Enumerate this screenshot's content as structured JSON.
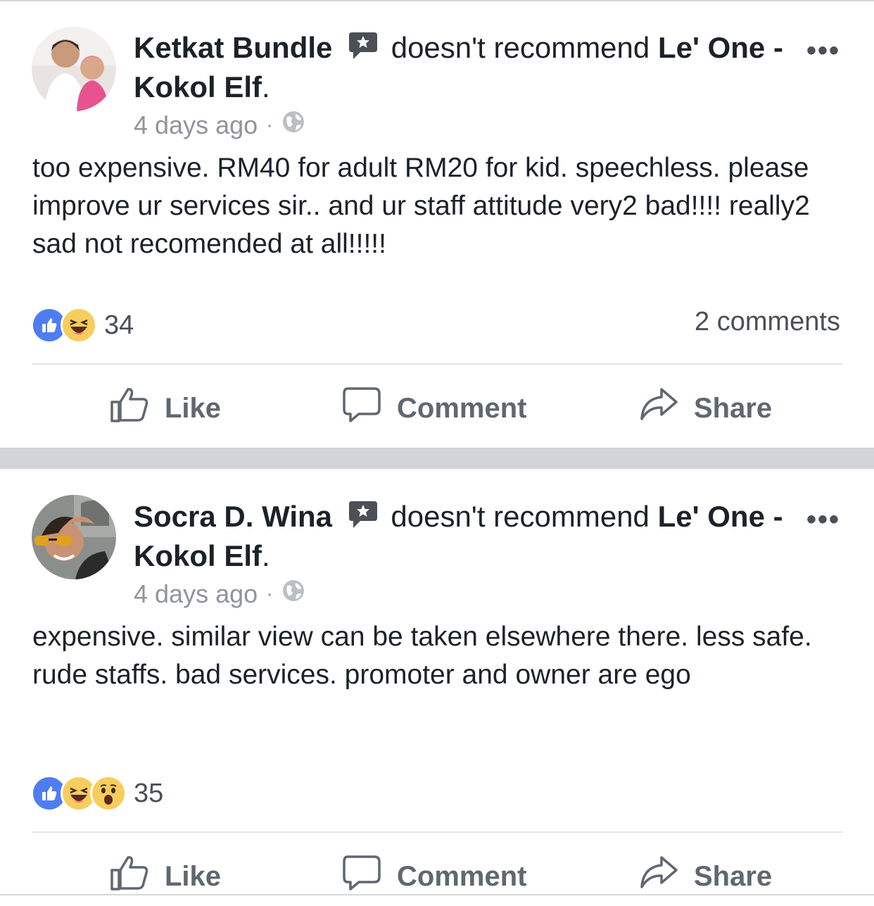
{
  "colors": {
    "like_blue": "#4267b2",
    "haha_yellow": "#f7cd5c",
    "meta_gray": "#90949c",
    "action_gray": "#606770"
  },
  "posts": [
    {
      "author": "Ketkat Bundle",
      "verb": "doesn't recommend",
      "page_name": "Le' One - Kokol Elf",
      "timestamp": "4 days ago",
      "text": "too expensive.  RM40 for adult RM20 for kid. speechless. please improve ur services sir.. and ur staff attitude very2 bad!!!!  really2 sad not recomended at all!!!!!",
      "reactions": [
        "like-icon",
        "haha-icon"
      ],
      "reaction_count": "34",
      "comments": "2 comments",
      "actions": {
        "like": "Like",
        "comment": "Comment",
        "share": "Share"
      }
    },
    {
      "author": "Socra D. Wina",
      "verb": "doesn't recommend",
      "page_name": "Le' One - Kokol Elf",
      "timestamp": "4 days ago",
      "text": "expensive. similar view can be taken elsewhere there. less safe. rude staffs. bad services. promoter and owner are ego",
      "reactions": [
        "like-icon",
        "haha-icon",
        "wow-icon"
      ],
      "reaction_count": "35",
      "comments": "",
      "actions": {
        "like": "Like",
        "comment": "Comment",
        "share": "Share"
      }
    }
  ],
  "ui": {
    "more_glyph": "•••",
    "meta_dot": "·",
    "period": "."
  }
}
